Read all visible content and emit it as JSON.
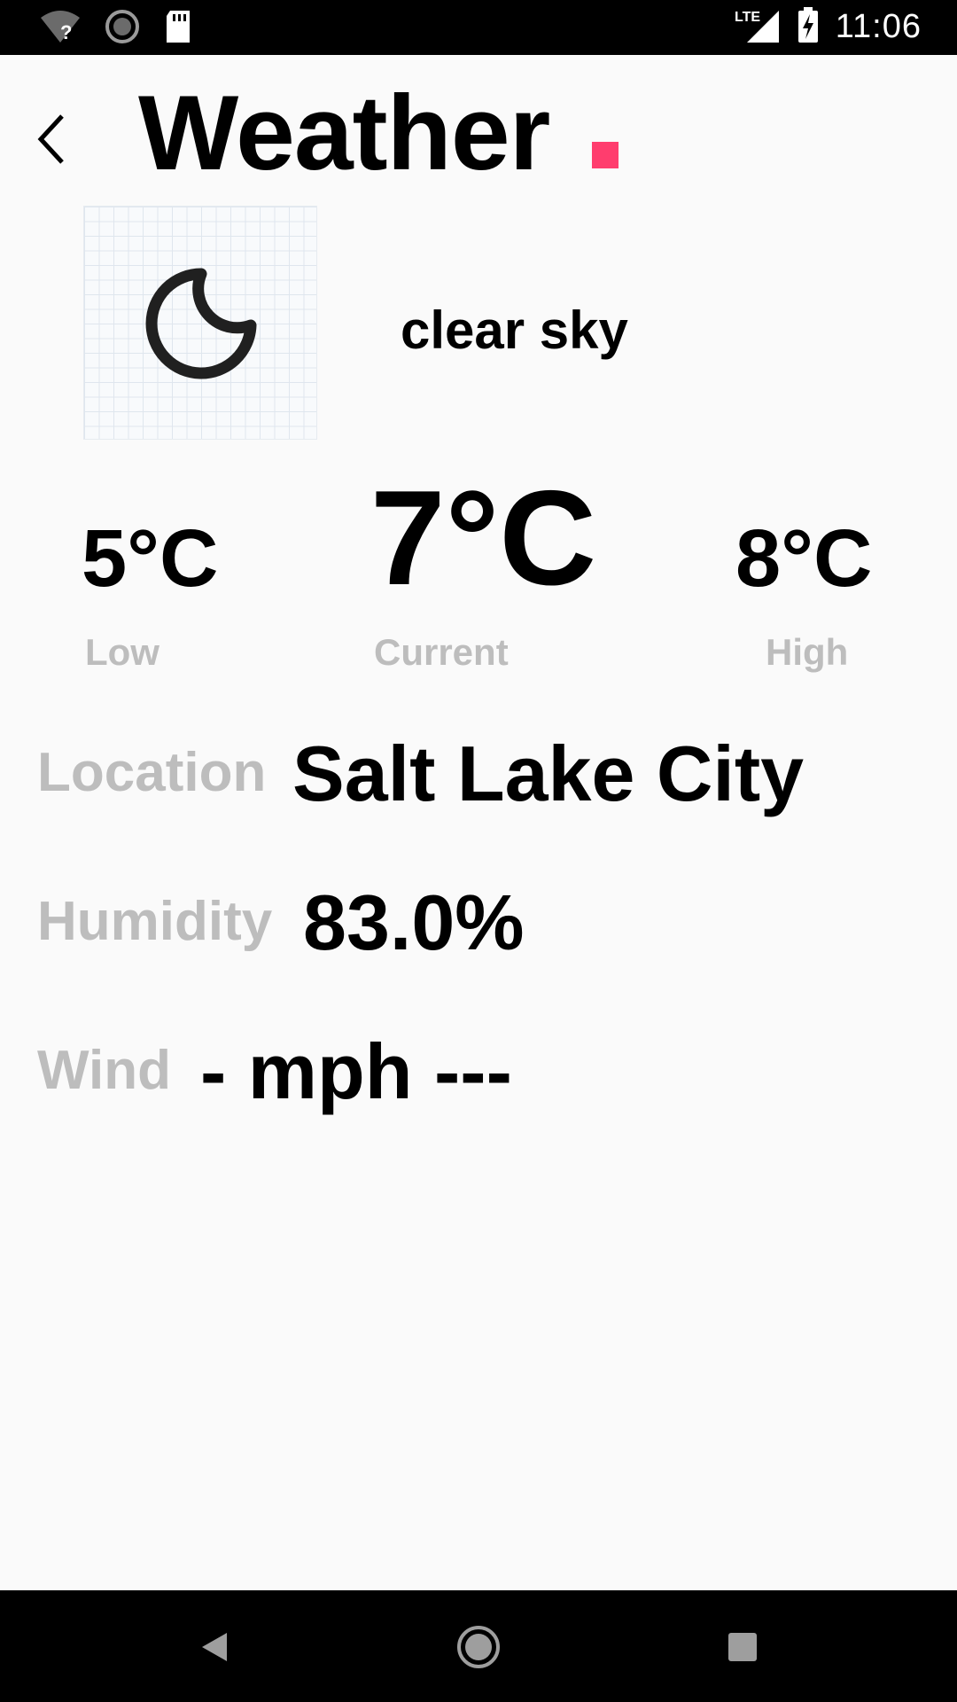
{
  "status_bar": {
    "time": "11:06",
    "network_label": "LTE",
    "icons": [
      "wifi-unknown-icon",
      "sync-icon",
      "sd-card-icon",
      "signal-icon",
      "battery-charging-icon"
    ]
  },
  "header": {
    "title": "Weather",
    "back_icon": "back-arrow-icon",
    "accent_color": "#ff3d6e"
  },
  "weather": {
    "icon": "moon-icon",
    "condition": "clear sky",
    "low": "5°C",
    "current": "7°C",
    "high": "8°C",
    "low_label": "Low",
    "current_label": "Current",
    "high_label": "High"
  },
  "details": {
    "location_label": "Location",
    "location_value": "Salt Lake City",
    "humidity_label": "Humidity",
    "humidity_value": "83.0%",
    "wind_label": "Wind",
    "wind_value": "- mph ---"
  },
  "nav_bar": {
    "icons": [
      "nav-back-icon",
      "nav-home-icon",
      "nav-recents-icon"
    ]
  }
}
